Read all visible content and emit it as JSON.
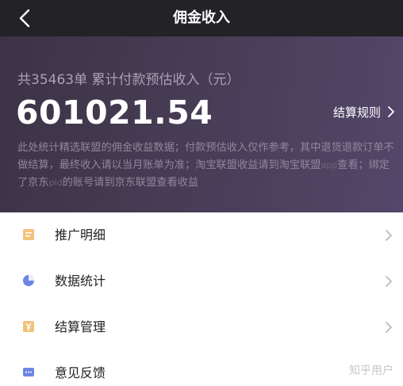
{
  "nav": {
    "title": "佣金收入"
  },
  "hero": {
    "summary": "共35463单 累计付款预估收入（元）",
    "amount": "601021.54",
    "rules_label": "结算规则",
    "note_a": "此处统计精选联盟的佣金收益数据；付款预估收入仅作参考，其中退货退款订单不做结算，最终收入请以当月账单为准；淘宝联盟收益请到淘宝联盟",
    "note_wm1": "app",
    "note_b": "查看；绑定了京东",
    "note_wm2": "pid",
    "note_c": "的账号请到京东联盟查看收益"
  },
  "menu": [
    {
      "label": "推广明细",
      "icon": "document-icon",
      "color": "#f2c27a"
    },
    {
      "label": "数据统计",
      "icon": "pie-chart-icon",
      "color": "#6d86e6"
    },
    {
      "label": "结算管理",
      "icon": "yen-icon",
      "color": "#f2c27a"
    },
    {
      "label": "意见反馈",
      "icon": "chat-icon",
      "color": "#6d86e6"
    }
  ],
  "watermark": "知乎用户"
}
